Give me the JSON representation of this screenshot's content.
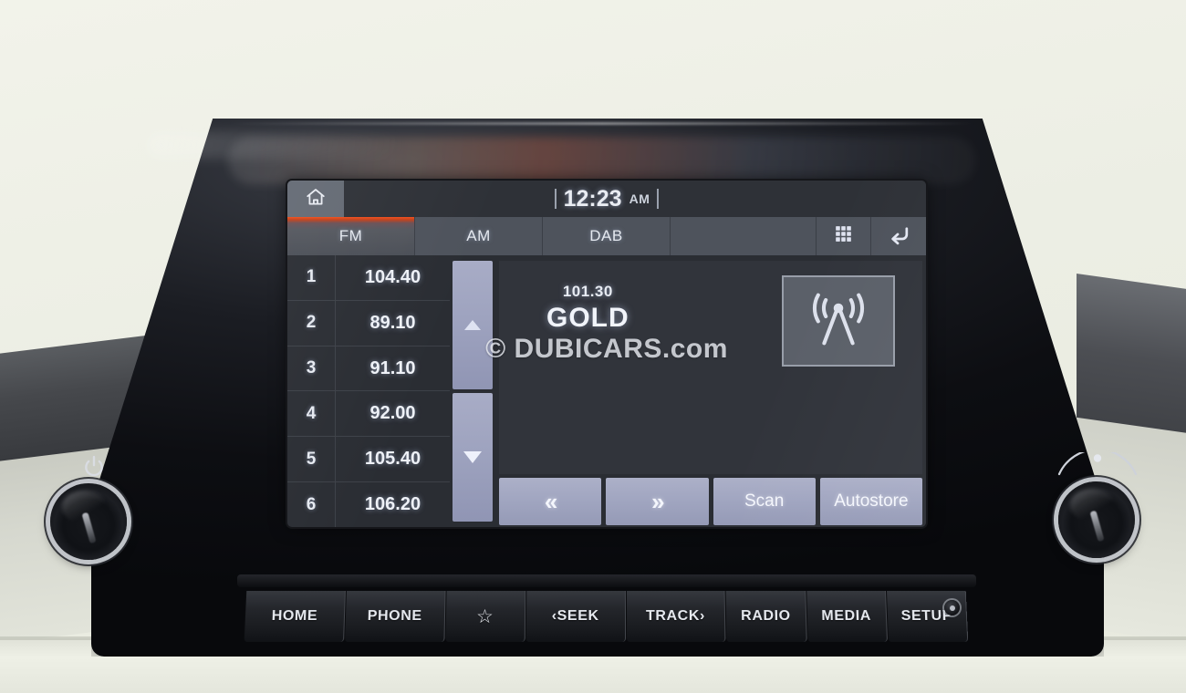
{
  "device": {
    "name": "car-infotainment-head-unit",
    "watermark": "© DUBICARS.com"
  },
  "statusbar": {
    "home_icon": "home-icon",
    "clock_time": "12:23",
    "clock_meridiem": "AM"
  },
  "tabs": [
    {
      "label": "FM",
      "active": true
    },
    {
      "label": "AM",
      "active": false
    },
    {
      "label": "DAB",
      "active": false
    }
  ],
  "tab_icons": [
    {
      "name": "grid-list-icon"
    },
    {
      "name": "back-arrow-icon"
    }
  ],
  "presets": [
    {
      "num": "1",
      "freq": "104.40"
    },
    {
      "num": "2",
      "freq": "89.10"
    },
    {
      "num": "3",
      "freq": "91.10"
    },
    {
      "num": "4",
      "freq": "92.00"
    },
    {
      "num": "5",
      "freq": "105.40"
    },
    {
      "num": "6",
      "freq": "106.20"
    }
  ],
  "scroll": {
    "up_label": "scroll-up",
    "down_label": "scroll-down"
  },
  "now_playing": {
    "frequency": "101.30",
    "station": "GOLD",
    "source_icon": "radio-antenna-icon"
  },
  "actions": [
    {
      "label": "«",
      "name": "seek-down-button"
    },
    {
      "label": "»",
      "name": "seek-up-button"
    },
    {
      "label": "Scan",
      "name": "scan-button"
    },
    {
      "label": "Autostore",
      "name": "autostore-button"
    }
  ],
  "hardware_buttons": [
    {
      "label": "HOME",
      "name": "hw-home-button"
    },
    {
      "label": "PHONE",
      "name": "hw-phone-button"
    },
    {
      "label": "☆",
      "name": "hw-favorite-button"
    },
    {
      "label": "‹SEEK",
      "name": "hw-seek-button"
    },
    {
      "label": "TRACK›",
      "name": "hw-track-button"
    },
    {
      "label": "RADIO",
      "name": "hw-radio-button"
    },
    {
      "label": "MEDIA",
      "name": "hw-media-button"
    },
    {
      "label": "SETUP",
      "name": "hw-setup-button"
    }
  ],
  "knobs": {
    "left_name": "power-volume-knob",
    "left_icon": "power-icon",
    "right_name": "tune-knob",
    "right_icon": "tune-arc-icon"
  },
  "colors": {
    "accent_active_tab": "#f04f1c",
    "screen_bg": "#2a2d33",
    "panel_bg": "#31343b",
    "button_lavender": "#a0a5c0",
    "tab_bg": "#4e535c",
    "text_light": "#eef1f7"
  }
}
